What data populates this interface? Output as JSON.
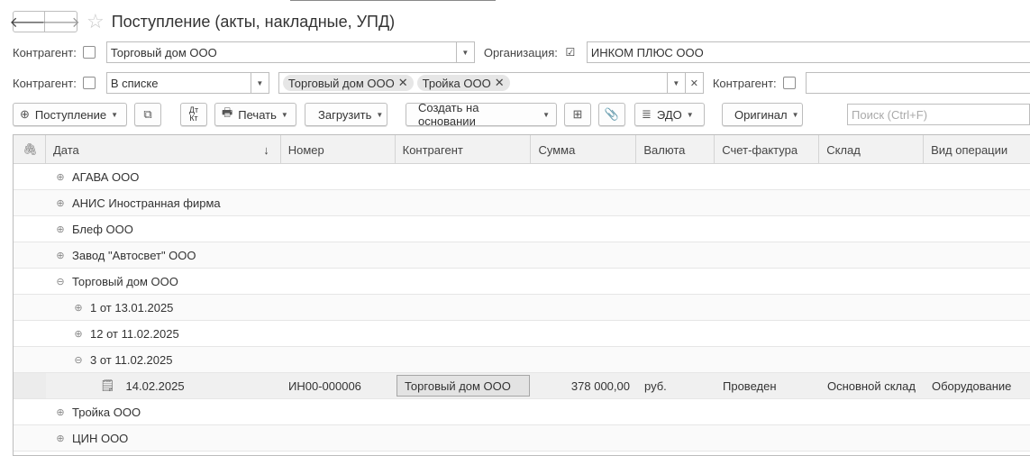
{
  "window": {
    "title": "Поступление (акты, накладные, УПД)"
  },
  "filters": {
    "row1": {
      "kontragent_label": "Контрагент:",
      "kontragent_value": "Торговый дом ООО",
      "org_label": "Организация:",
      "org_value": "ИНКОМ ПЛЮС ООО"
    },
    "row2": {
      "kontragent_label": "Контрагент:",
      "mode_value": "В списке",
      "tags": [
        "Торговый дом ООО",
        "Тройка ООО"
      ],
      "kontragent2_label": "Контрагент:"
    }
  },
  "toolbar": {
    "postuplenie": "Поступление",
    "dtkt": "Дт Кт",
    "print": "Печать",
    "load": "Загрузить",
    "create_based": "Создать на основании",
    "edo": "ЭДО",
    "original": "Оригинал",
    "search_placeholder": "Поиск (Ctrl+F)"
  },
  "grid": {
    "columns": [
      "Дата",
      "Номер",
      "Контрагент",
      "Сумма",
      "Валюта",
      "Счет-фактура",
      "Склад",
      "Вид операции"
    ],
    "groups": [
      {
        "label": "АГАВА  ООО",
        "expander": "⊕"
      },
      {
        "label": "АНИС  Иностранная фирма",
        "expander": "⊕"
      },
      {
        "label": "Блеф ООО",
        "expander": "⊕"
      },
      {
        "label": "Завод \"Автосвет\" ООО",
        "expander": "⊕"
      },
      {
        "label": "Торговый дом ООО",
        "expander": "⊖"
      },
      {
        "label": "1 от 13.01.2025",
        "expander": "⊕"
      },
      {
        "label": "12 от 11.02.2025",
        "expander": "⊕"
      },
      {
        "label": "3 от 11.02.2025",
        "expander": "⊖"
      },
      {
        "label": "Тройка ООО",
        "expander": "⊕"
      },
      {
        "label": "ЦИН ООО",
        "expander": "⊕"
      }
    ],
    "doc_row": {
      "date": "14.02.2025",
      "number": "ИН00-000006",
      "kontragent": "Торговый дом ООО",
      "sum": "378 000,00",
      "currency": "руб.",
      "invoice": "Проведен",
      "warehouse": "Основной склад",
      "operation": "Оборудование"
    }
  }
}
